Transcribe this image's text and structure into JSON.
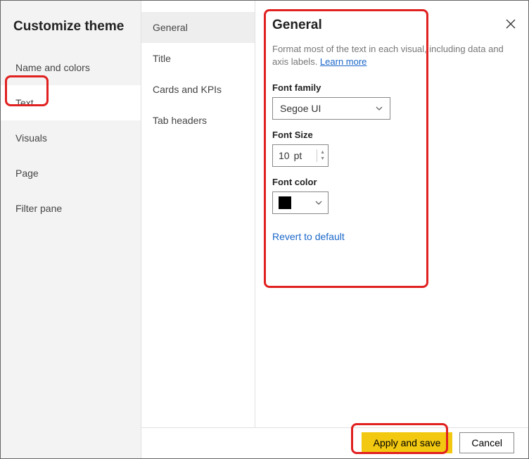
{
  "title": "Customize theme",
  "sidebar1": {
    "items": [
      {
        "label": "Name and colors"
      },
      {
        "label": "Text"
      },
      {
        "label": "Visuals"
      },
      {
        "label": "Page"
      },
      {
        "label": "Filter pane"
      }
    ]
  },
  "sidebar2": {
    "items": [
      {
        "label": "General"
      },
      {
        "label": "Title"
      },
      {
        "label": "Cards and KPIs"
      },
      {
        "label": "Tab headers"
      }
    ]
  },
  "panel": {
    "heading": "General",
    "desc_prefix": "Format most of the text in each visual, including data and axis labels. ",
    "learn_more": "Learn more",
    "font_family_label": "Font family",
    "font_family_value": "Segoe UI",
    "font_size_label": "Font Size",
    "font_size_value": "10",
    "font_size_unit": "pt",
    "font_color_label": "Font color",
    "font_color_value": "#000000",
    "revert": "Revert to default"
  },
  "footer": {
    "apply": "Apply and save",
    "cancel": "Cancel"
  }
}
